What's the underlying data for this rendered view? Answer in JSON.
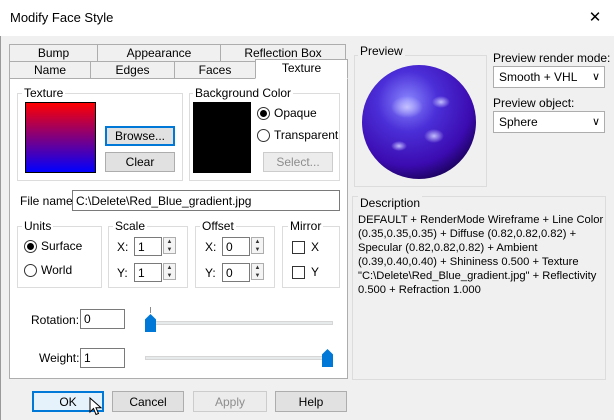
{
  "window": {
    "title": "Modify Face Style",
    "close_glyph": "✕"
  },
  "tabs": {
    "row1": [
      "Bump",
      "Appearance",
      "Reflection Box"
    ],
    "row2": [
      "Name",
      "Edges",
      "Faces",
      "Texture"
    ],
    "selected": "Texture"
  },
  "texture": {
    "group_label": "Texture",
    "browse_label": "Browse...",
    "clear_label": "Clear",
    "gradient_colors": [
      "#ff0000",
      "#0000ff"
    ]
  },
  "background": {
    "group_label": "Background Color",
    "opaque_label": "Opaque",
    "transparent_label": "Transparent",
    "select_label": "Select...",
    "selected": "Opaque",
    "swatch_color": "#000000"
  },
  "file": {
    "label": "File name:",
    "value": "C:\\Delete\\Red_Blue_gradient.jpg"
  },
  "units": {
    "label": "Units",
    "surface_label": "Surface",
    "world_label": "World",
    "selected": "Surface"
  },
  "scale": {
    "label": "Scale",
    "x_label": "X:",
    "y_label": "Y:",
    "x_value": "1",
    "y_value": "1"
  },
  "offset": {
    "label": "Offset",
    "x_label": "X:",
    "y_label": "Y:",
    "x_value": "0",
    "y_value": "0"
  },
  "mirror": {
    "label": "Mirror",
    "x_label": "X",
    "y_label": "Y",
    "x_checked": false,
    "y_checked": false
  },
  "rotation": {
    "label": "Rotation:",
    "value": "0",
    "slider_fraction": 0
  },
  "weight": {
    "label": "Weight:",
    "value": "1",
    "slider_fraction": 1
  },
  "preview": {
    "label": "Preview",
    "render_mode_label": "Preview render mode:",
    "render_mode_value": "Smooth + VHL",
    "object_label": "Preview object:",
    "object_value": "Sphere"
  },
  "description": {
    "label": "Description",
    "lines": [
      "DEFAULT + RenderMode Wireframe + Line Color",
      "(0.35,0.35,0.35) + Diffuse (0.82,0.82,0.82) +",
      "Specular (0.82,0.82,0.82) + Ambient",
      "(0.39,0.40,0.40) + Shininess 0.500 + Texture",
      "\"C:\\Delete\\Red_Blue_gradient.jpg\" + Reflectivity",
      "0.500 + Refraction 1.000"
    ]
  },
  "buttons": {
    "ok": "OK",
    "cancel": "Cancel",
    "apply": "Apply",
    "help": "Help"
  },
  "colors": {
    "accent": "#0078d7",
    "slider_thumb": "#0078d7"
  }
}
